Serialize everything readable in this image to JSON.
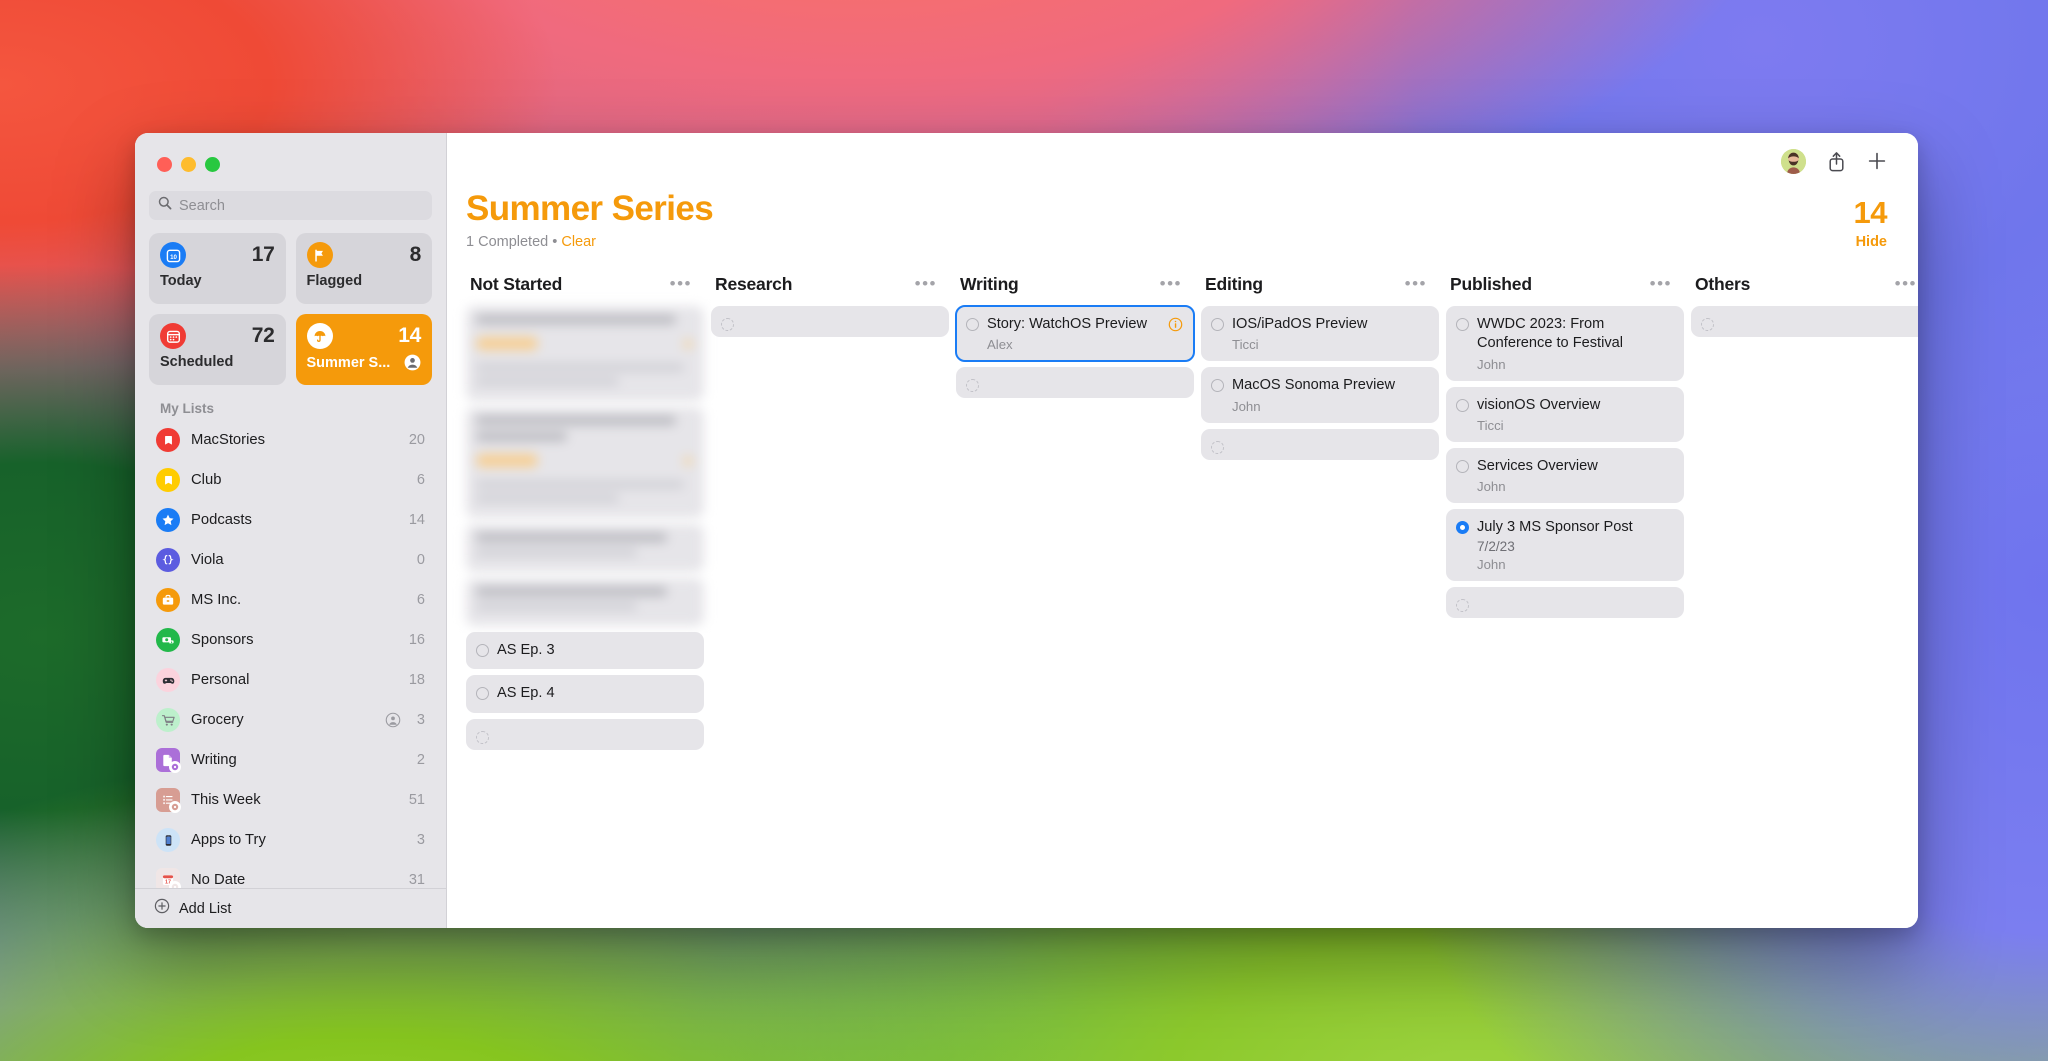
{
  "window": {
    "traffic_lights": [
      "close",
      "minimize",
      "maximize"
    ]
  },
  "sidebar": {
    "search": {
      "placeholder": "Search",
      "value": "",
      "icon": "search-icon"
    },
    "tiles": [
      {
        "id": "today",
        "label": "Today",
        "count": "17",
        "icon": "calendar-day-icon",
        "active": false,
        "shared": false
      },
      {
        "id": "flagged",
        "label": "Flagged",
        "count": "8",
        "icon": "flag-icon",
        "active": false,
        "shared": false
      },
      {
        "id": "scheduled",
        "label": "Scheduled",
        "count": "72",
        "icon": "calendar-icon",
        "active": false,
        "shared": false
      },
      {
        "id": "summer",
        "label": "Summer S...",
        "count": "14",
        "icon": "umbrella-icon",
        "active": true,
        "shared": true
      }
    ],
    "section_title": "My Lists",
    "lists": [
      {
        "label": "MacStories",
        "count": "20",
        "icon": "bookmark-icon",
        "color": "#f03b34",
        "shape": "round",
        "smart": false,
        "shared": false
      },
      {
        "label": "Club",
        "count": "6",
        "icon": "bookmark-icon",
        "color": "#ffcc00",
        "shape": "round",
        "smart": false,
        "shared": false
      },
      {
        "label": "Podcasts",
        "count": "14",
        "icon": "star-icon",
        "color": "#1a7cf5",
        "shape": "round",
        "smart": false,
        "shared": false
      },
      {
        "label": "Viola",
        "count": "0",
        "icon": "braces-icon",
        "color": "#5c5ce0",
        "shape": "round",
        "smart": false,
        "shared": false
      },
      {
        "label": "MS Inc.",
        "count": "6",
        "icon": "briefcase-icon",
        "color": "#f59a0b",
        "shape": "round",
        "smart": false,
        "shared": false
      },
      {
        "label": "Sponsors",
        "count": "16",
        "icon": "money-icon",
        "color": "#22b84a",
        "shape": "round",
        "smart": false,
        "shared": false
      },
      {
        "label": "Personal",
        "count": "18",
        "icon": "gamepad-icon",
        "color": "#fbd3dd",
        "shape": "round",
        "smart": false,
        "shared": false
      },
      {
        "label": "Grocery",
        "count": "3",
        "icon": "cart-icon",
        "color": "#bdf0cc",
        "shape": "round",
        "smart": false,
        "shared": true
      },
      {
        "label": "Writing",
        "count": "2",
        "icon": "document-icon",
        "color": "#ab6fd8",
        "shape": "sq",
        "smart": true,
        "shared": false
      },
      {
        "label": "This Week",
        "count": "51",
        "icon": "checklist-icon",
        "color": "#d79d93",
        "shape": "sq",
        "smart": true,
        "shared": false
      },
      {
        "label": "Apps to Try",
        "count": "3",
        "icon": "iphone-icon",
        "color": "#cde3f7",
        "shape": "round",
        "smart": false,
        "shared": false
      },
      {
        "label": "No Date",
        "count": "31",
        "icon": "calendar-17-icon",
        "color": "#f0e6e6",
        "shape": "sq",
        "smart": true,
        "shared": false
      }
    ],
    "footer": {
      "label": "Add List",
      "icon": "plus-circle-icon"
    }
  },
  "toolbar": {
    "avatar": "user-avatar",
    "share_label": "share-icon",
    "add_label": "plus-icon"
  },
  "header": {
    "title": "Summer Series",
    "completed_text": "1 Completed",
    "separator": "•",
    "clear_label": "Clear",
    "count": "14",
    "hide_label": "Hide"
  },
  "board": {
    "more_glyph": "•••",
    "columns": [
      {
        "title": "Not Started",
        "cards": [
          {
            "type": "blurred",
            "variant": "tall"
          },
          {
            "type": "blurred",
            "variant": "tall2"
          },
          {
            "type": "blurred",
            "variant": "short"
          },
          {
            "type": "blurred",
            "variant": "short"
          },
          {
            "title": "AS Ep. 3",
            "date": "",
            "person": "",
            "state": "open",
            "info": false
          },
          {
            "title": "AS Ep. 4",
            "date": "",
            "person": "",
            "state": "open",
            "info": false
          },
          {
            "type": "empty"
          }
        ]
      },
      {
        "title": "Research",
        "cards": [
          {
            "type": "empty"
          }
        ]
      },
      {
        "title": "Writing",
        "cards": [
          {
            "title": "Story: WatchOS Preview",
            "date": "",
            "person": "Alex",
            "state": "open",
            "info": true,
            "selected": true
          },
          {
            "type": "empty"
          }
        ]
      },
      {
        "title": "Editing",
        "cards": [
          {
            "title": "IOS/iPadOS Preview",
            "date": "",
            "person": "Ticci",
            "state": "open",
            "info": false
          },
          {
            "title": "MacOS Sonoma Preview",
            "date": "",
            "person": "John",
            "state": "open",
            "info": false
          },
          {
            "type": "empty"
          }
        ]
      },
      {
        "title": "Published",
        "cards": [
          {
            "title": "WWDC 2023: From Conference to Festival",
            "date": "",
            "person": "John",
            "state": "open",
            "info": false
          },
          {
            "title": "visionOS Overview",
            "date": "",
            "person": "Ticci",
            "state": "open",
            "info": false
          },
          {
            "title": "Services Overview",
            "date": "",
            "person": "John",
            "state": "open",
            "info": false
          },
          {
            "title": "July 3 MS Sponsor Post",
            "date": "7/2/23",
            "person": "John",
            "state": "done",
            "info": false
          },
          {
            "type": "empty"
          }
        ]
      },
      {
        "title": "Others",
        "cards": [
          {
            "type": "empty"
          }
        ]
      }
    ]
  },
  "colors": {
    "accent": "#f59a0b",
    "selection": "#1a7cf5",
    "sidebar_bg": "#e6e5e9",
    "card_bg": "#e6e5e9",
    "muted_text": "#8e8e93"
  }
}
